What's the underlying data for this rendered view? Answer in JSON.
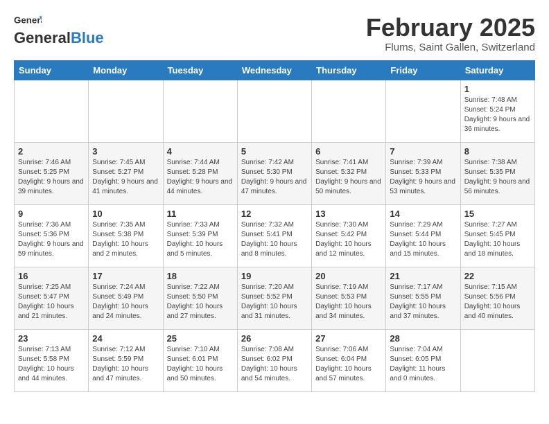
{
  "header": {
    "logo_general": "General",
    "logo_blue": "Blue",
    "month_year": "February 2025",
    "location": "Flums, Saint Gallen, Switzerland"
  },
  "weekdays": [
    "Sunday",
    "Monday",
    "Tuesday",
    "Wednesday",
    "Thursday",
    "Friday",
    "Saturday"
  ],
  "weeks": [
    [
      {
        "day": "",
        "info": ""
      },
      {
        "day": "",
        "info": ""
      },
      {
        "day": "",
        "info": ""
      },
      {
        "day": "",
        "info": ""
      },
      {
        "day": "",
        "info": ""
      },
      {
        "day": "",
        "info": ""
      },
      {
        "day": "1",
        "info": "Sunrise: 7:48 AM\nSunset: 5:24 PM\nDaylight: 9 hours and 36 minutes."
      }
    ],
    [
      {
        "day": "2",
        "info": "Sunrise: 7:46 AM\nSunset: 5:25 PM\nDaylight: 9 hours and 39 minutes."
      },
      {
        "day": "3",
        "info": "Sunrise: 7:45 AM\nSunset: 5:27 PM\nDaylight: 9 hours and 41 minutes."
      },
      {
        "day": "4",
        "info": "Sunrise: 7:44 AM\nSunset: 5:28 PM\nDaylight: 9 hours and 44 minutes."
      },
      {
        "day": "5",
        "info": "Sunrise: 7:42 AM\nSunset: 5:30 PM\nDaylight: 9 hours and 47 minutes."
      },
      {
        "day": "6",
        "info": "Sunrise: 7:41 AM\nSunset: 5:32 PM\nDaylight: 9 hours and 50 minutes."
      },
      {
        "day": "7",
        "info": "Sunrise: 7:39 AM\nSunset: 5:33 PM\nDaylight: 9 hours and 53 minutes."
      },
      {
        "day": "8",
        "info": "Sunrise: 7:38 AM\nSunset: 5:35 PM\nDaylight: 9 hours and 56 minutes."
      }
    ],
    [
      {
        "day": "9",
        "info": "Sunrise: 7:36 AM\nSunset: 5:36 PM\nDaylight: 9 hours and 59 minutes."
      },
      {
        "day": "10",
        "info": "Sunrise: 7:35 AM\nSunset: 5:38 PM\nDaylight: 10 hours and 2 minutes."
      },
      {
        "day": "11",
        "info": "Sunrise: 7:33 AM\nSunset: 5:39 PM\nDaylight: 10 hours and 5 minutes."
      },
      {
        "day": "12",
        "info": "Sunrise: 7:32 AM\nSunset: 5:41 PM\nDaylight: 10 hours and 8 minutes."
      },
      {
        "day": "13",
        "info": "Sunrise: 7:30 AM\nSunset: 5:42 PM\nDaylight: 10 hours and 12 minutes."
      },
      {
        "day": "14",
        "info": "Sunrise: 7:29 AM\nSunset: 5:44 PM\nDaylight: 10 hours and 15 minutes."
      },
      {
        "day": "15",
        "info": "Sunrise: 7:27 AM\nSunset: 5:45 PM\nDaylight: 10 hours and 18 minutes."
      }
    ],
    [
      {
        "day": "16",
        "info": "Sunrise: 7:25 AM\nSunset: 5:47 PM\nDaylight: 10 hours and 21 minutes."
      },
      {
        "day": "17",
        "info": "Sunrise: 7:24 AM\nSunset: 5:49 PM\nDaylight: 10 hours and 24 minutes."
      },
      {
        "day": "18",
        "info": "Sunrise: 7:22 AM\nSunset: 5:50 PM\nDaylight: 10 hours and 27 minutes."
      },
      {
        "day": "19",
        "info": "Sunrise: 7:20 AM\nSunset: 5:52 PM\nDaylight: 10 hours and 31 minutes."
      },
      {
        "day": "20",
        "info": "Sunrise: 7:19 AM\nSunset: 5:53 PM\nDaylight: 10 hours and 34 minutes."
      },
      {
        "day": "21",
        "info": "Sunrise: 7:17 AM\nSunset: 5:55 PM\nDaylight: 10 hours and 37 minutes."
      },
      {
        "day": "22",
        "info": "Sunrise: 7:15 AM\nSunset: 5:56 PM\nDaylight: 10 hours and 40 minutes."
      }
    ],
    [
      {
        "day": "23",
        "info": "Sunrise: 7:13 AM\nSunset: 5:58 PM\nDaylight: 10 hours and 44 minutes."
      },
      {
        "day": "24",
        "info": "Sunrise: 7:12 AM\nSunset: 5:59 PM\nDaylight: 10 hours and 47 minutes."
      },
      {
        "day": "25",
        "info": "Sunrise: 7:10 AM\nSunset: 6:01 PM\nDaylight: 10 hours and 50 minutes."
      },
      {
        "day": "26",
        "info": "Sunrise: 7:08 AM\nSunset: 6:02 PM\nDaylight: 10 hours and 54 minutes."
      },
      {
        "day": "27",
        "info": "Sunrise: 7:06 AM\nSunset: 6:04 PM\nDaylight: 10 hours and 57 minutes."
      },
      {
        "day": "28",
        "info": "Sunrise: 7:04 AM\nSunset: 6:05 PM\nDaylight: 11 hours and 0 minutes."
      },
      {
        "day": "",
        "info": ""
      }
    ]
  ]
}
